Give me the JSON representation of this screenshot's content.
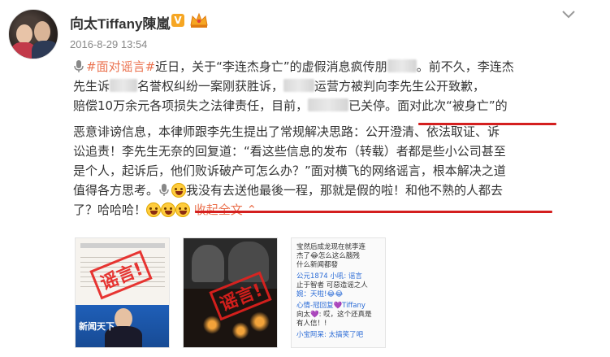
{
  "user": {
    "name": "向太Tiffany陳嵐",
    "verified": "V",
    "timestamp": "2016-8-29 13:54"
  },
  "icons": {
    "chevron": "chevron-down-icon",
    "mic": "microphone-icon",
    "crown": "crown-icon",
    "emoji": "laughing-emoji-icon"
  },
  "colors": {
    "link": "#eb7350",
    "underline": "#d41f1f",
    "verified": "#f6a623"
  },
  "post": {
    "l1_hashtag": "#面对谣言#",
    "l1_text": "近日，关于“李连杰身亡”的虚假消息疯传朋",
    "l1_text2": "。前不久，李连杰",
    "l2_text1": "先生诉",
    "l2_text2": "名誉权纠纷一案刚获胜诉，",
    "l2_text3": "运营方被判向李先生公开致歉，",
    "l3_text1": "赔偿10万余元各项损失之法律责任，目前，",
    "l3_text2": "已关停。面对此次“被身亡”的",
    "l4": "恶意诽谤信息，本律师跟李先生提出了常规解决思路：公开澄清、依法取证、诉",
    "l5": "讼追责！李先生无奈的回复道：“看这些信息的发布（转载）者都是些小公司甚至",
    "l6": "是个人，起诉后，他们败诉破产可怎么办？”面对横飞的网络谣言，根本解决之道",
    "l7_text": "值得各方思考。",
    "l7_quote": "我没有去送他最後一程，那就是假的啦！和他不熟的人都去",
    "l8_text": "了？哈哈哈！",
    "l8_link": "收起全文",
    "l8_chevron": "⌃"
  },
  "thumbnails": {
    "t1": {
      "stamp": "谣言!",
      "caption": "新闻天下"
    },
    "t2": {
      "stamp": "谣言!"
    },
    "t3": {
      "lines": [
        "宝然后成龙现在就李连",
        "杰了😂怎么这么腦残",
        "什么新闻都發",
        "公元1874 小吼: 谣言",
        "止于智者 可惡造谣之人",
        "婉：天啦!😂😂",
        "心情-冠回复💜Tiffany",
        "向太💜: 哎，这个还真是",
        "有人信！!",
        "小宝阿呆: 太搞笑了吧"
      ]
    }
  }
}
